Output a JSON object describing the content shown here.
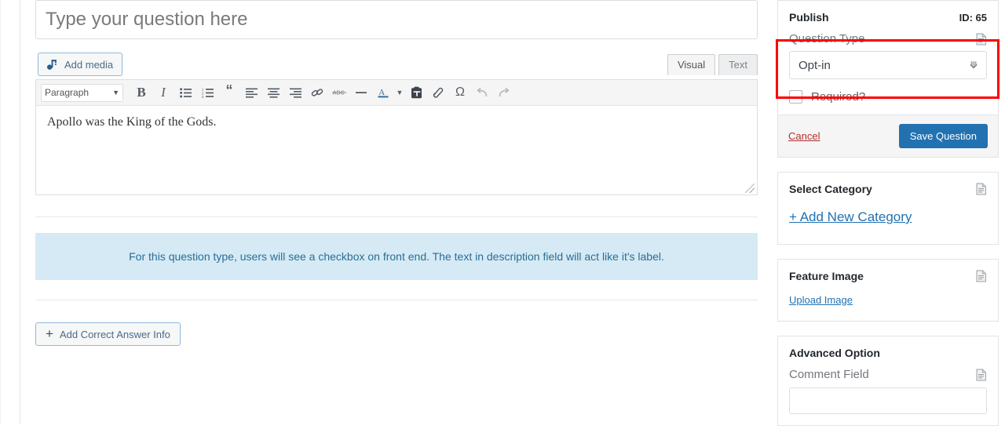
{
  "editor": {
    "title_placeholder": "Type your question here",
    "title_value": "",
    "add_media_label": "Add media",
    "tabs": [
      {
        "label": "Visual",
        "active": true
      },
      {
        "label": "Text",
        "active": false
      }
    ],
    "toolbar": {
      "format_select": "Paragraph",
      "buttons": [
        {
          "name": "bold",
          "glyph": "B"
        },
        {
          "name": "italic",
          "glyph": "I"
        },
        {
          "name": "bulleted-list",
          "glyph": "list"
        },
        {
          "name": "numbered-list",
          "glyph": "numlist"
        },
        {
          "name": "blockquote",
          "glyph": "“"
        },
        {
          "name": "align-left",
          "glyph": "alignleft"
        },
        {
          "name": "align-center",
          "glyph": "aligncenter"
        },
        {
          "name": "align-right",
          "glyph": "alignright"
        },
        {
          "name": "insert-link",
          "glyph": "link"
        },
        {
          "name": "strikethrough",
          "glyph": "ABC"
        },
        {
          "name": "horizontal-line",
          "glyph": "—"
        },
        {
          "name": "text-color",
          "glyph": "A"
        },
        {
          "name": "paste-as-text",
          "glyph": "clipboard"
        },
        {
          "name": "clear-formatting",
          "glyph": "eraser"
        },
        {
          "name": "special-character",
          "glyph": "Ω"
        },
        {
          "name": "undo",
          "glyph": "↶"
        },
        {
          "name": "redo",
          "glyph": "↷"
        }
      ]
    },
    "body_text": "Apollo was the King of the Gods."
  },
  "notice": {
    "text": "For this question type, users will see a checkbox on front end. The text in description field will act like it's label.",
    "background": "#d5eaf4",
    "color": "#2a6d96"
  },
  "answer_button": {
    "label": "Add Correct Answer Info",
    "plus": "+"
  },
  "sidebar": {
    "publish": {
      "title": "Publish",
      "id_label": "ID: 65",
      "question_type": {
        "label": "Question Type",
        "value": "Opt-in"
      },
      "required": {
        "label": "Required?",
        "checked": false
      },
      "cancel_label": "Cancel",
      "save_label": "Save Question"
    },
    "category": {
      "title": "Select Category",
      "add_link": "+ Add New Category"
    },
    "feature_image": {
      "title": "Feature Image",
      "upload_link": "Upload Image"
    },
    "advanced": {
      "title": "Advanced Option",
      "comment_field_label": "Comment Field",
      "comment_field_value": ""
    }
  },
  "annotation": {
    "highlight_color": "#fe0000",
    "target": "question-type-field"
  }
}
